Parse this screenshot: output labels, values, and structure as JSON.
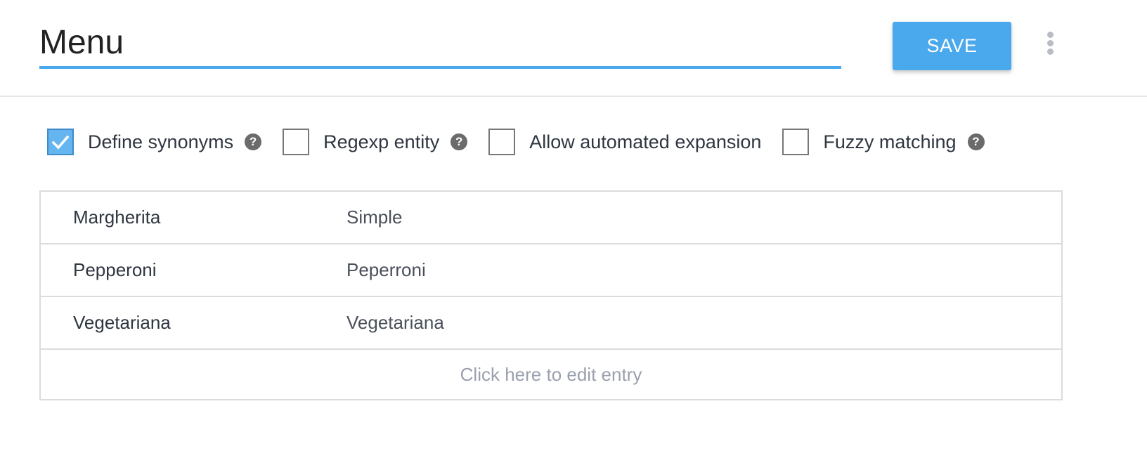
{
  "header": {
    "entity_name": "Menu",
    "save_label": "SAVE",
    "more_icon": "more-vertical-icon"
  },
  "colors": {
    "accent": "#4aa8ec",
    "checkbox_checked": "#64b5f0",
    "help_icon": "#6b6b6b",
    "placeholder_text": "#9aa0ad"
  },
  "options": [
    {
      "label": "Define synonyms",
      "checked": true,
      "has_help": true
    },
    {
      "label": "Regexp entity",
      "checked": false,
      "has_help": true
    },
    {
      "label": "Allow automated expansion",
      "checked": false,
      "has_help": false
    },
    {
      "label": "Fuzzy matching",
      "checked": false,
      "has_help": true
    }
  ],
  "entries": [
    {
      "value": "Margherita",
      "synonyms": "Simple"
    },
    {
      "value": "Pepperoni",
      "synonyms": "Peperroni"
    },
    {
      "value": "Vegetariana",
      "synonyms": "Vegetariana"
    }
  ],
  "edit_entry_placeholder": "Click here to edit entry"
}
